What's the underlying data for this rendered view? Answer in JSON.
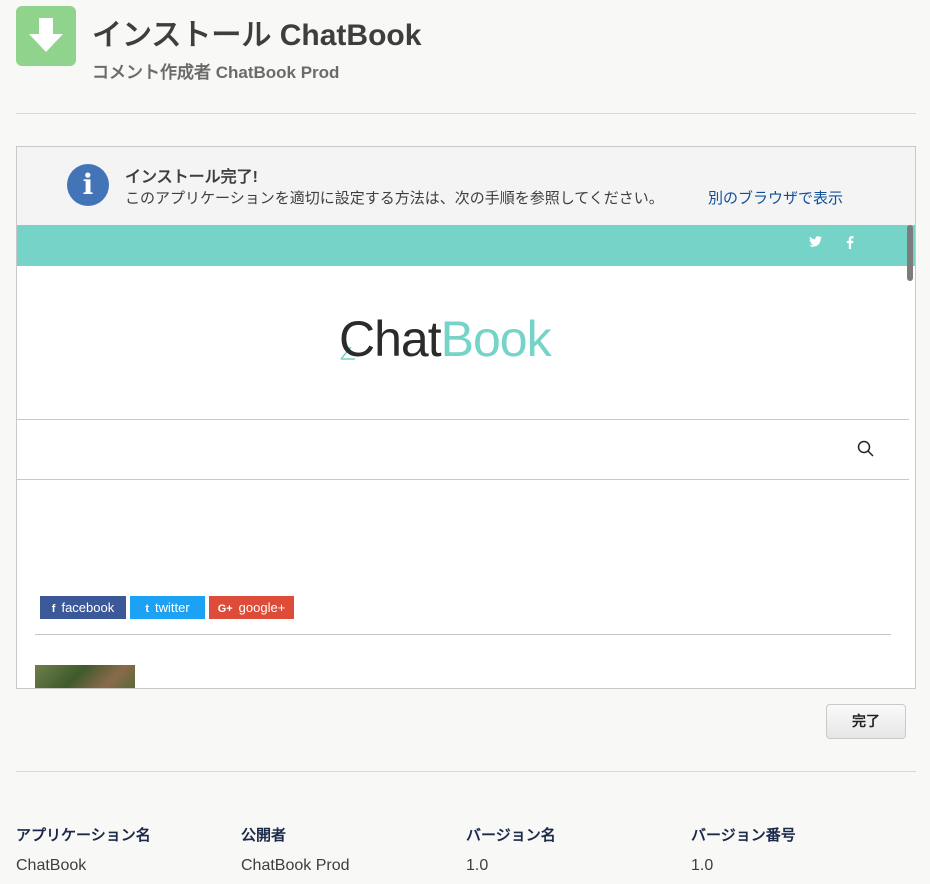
{
  "header": {
    "title": "インストール ChatBook",
    "subtitle": "コメント作成者 ChatBook Prod"
  },
  "notice": {
    "title": "インストール完了!",
    "body": "このアプリケーションを適切に設定する方法は、次の手順を参照してください。",
    "link": "別のブラウザで表示"
  },
  "preview": {
    "top_social": [
      "twitter-icon",
      "facebook-icon"
    ],
    "logo_part1": "Chat",
    "logo_part2": "Book",
    "share_buttons": [
      {
        "icon": "f",
        "label": "facebook"
      },
      {
        "icon": "t",
        "label": "twitter"
      },
      {
        "icon": "G+",
        "label": "google+"
      }
    ]
  },
  "actions": {
    "done": "完了"
  },
  "details": {
    "columns": [
      {
        "label": "アプリケーション名",
        "value": "ChatBook"
      },
      {
        "label": "公開者",
        "value": "ChatBook Prod"
      },
      {
        "label": "バージョン名",
        "value": "1.0"
      },
      {
        "label": "バージョン番号",
        "value": "1.0"
      }
    ]
  },
  "colors": {
    "accent_teal": "#76d3c8",
    "icon_green": "#8fd38c",
    "info_blue": "#4474b8",
    "link_blue": "#0f4f99",
    "facebook": "#3b5998",
    "twitter": "#1da1f2",
    "googleplus": "#dd4b39"
  }
}
